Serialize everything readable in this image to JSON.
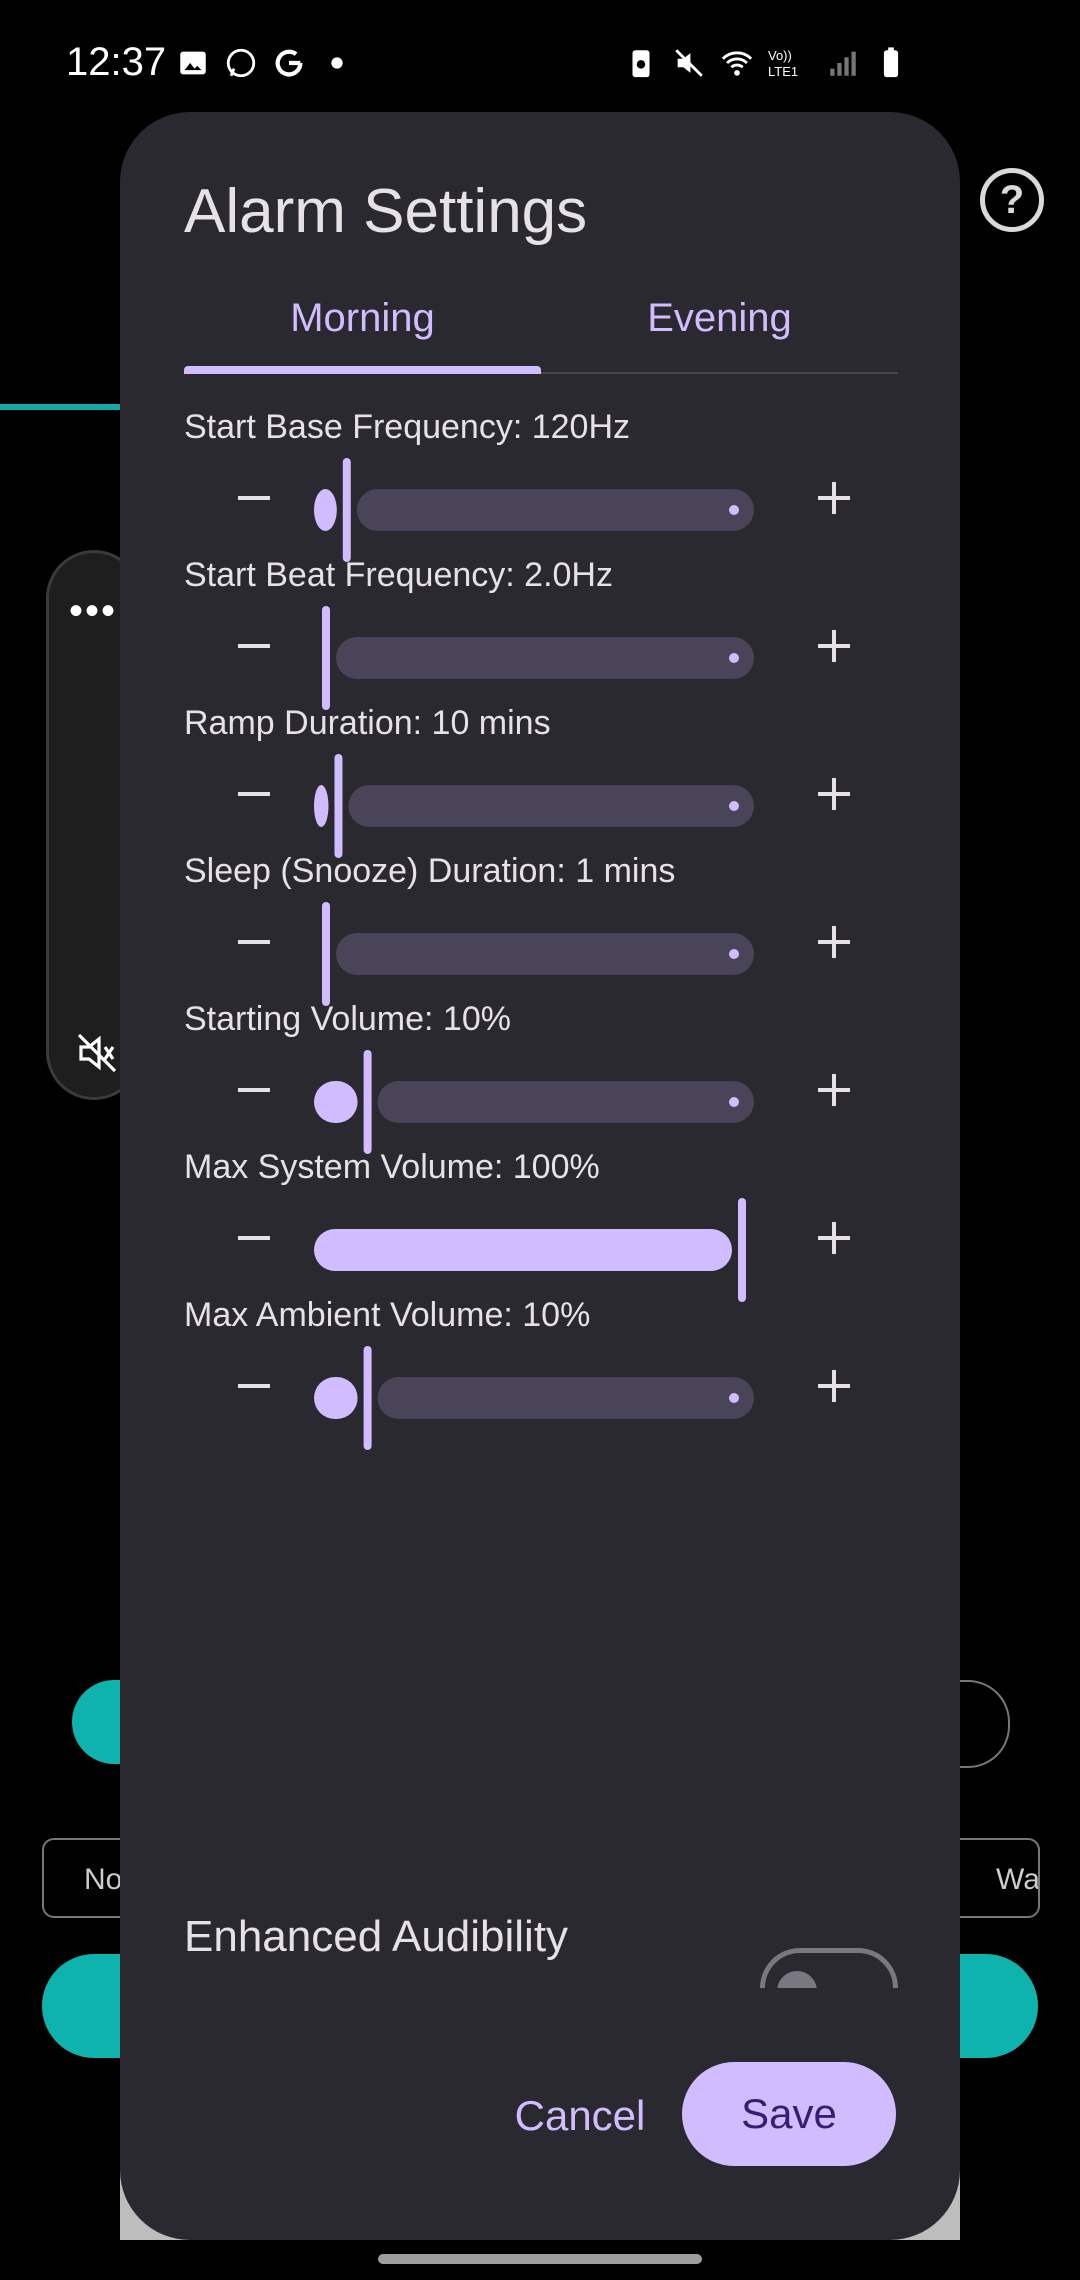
{
  "status_bar": {
    "time": "12:37",
    "left_icons": [
      "image-icon",
      "whatsapp-icon",
      "google-icon",
      "dot-icon"
    ],
    "right_icons": [
      "battery-saver-icon",
      "mute-icon",
      "wifi-icon",
      "volte-icon",
      "signal-icon",
      "battery-icon"
    ],
    "network_label": "Vo)) LTE1"
  },
  "background": {
    "help_icon": "help-icon",
    "chip_left": "No",
    "chip_right": "Wa"
  },
  "volume_panel": {
    "more_icon": "more-icon",
    "mute_icon": "volume-mute-icon"
  },
  "dialog": {
    "title": "Alarm Settings",
    "tabs": [
      {
        "label": "Morning",
        "selected": true
      },
      {
        "label": "Evening",
        "selected": false
      }
    ],
    "settings": [
      {
        "label": "Start Base Frequency: 120Hz",
        "fraction": 0.05
      },
      {
        "label": "Start Beat Frequency: 2.0Hz",
        "fraction": 0.0
      },
      {
        "label": "Ramp Duration: 10 mins",
        "fraction": 0.03
      },
      {
        "label": "Sleep (Snooze) Duration: 1 mins",
        "fraction": 0.0
      },
      {
        "label": "Starting Volume: 10%",
        "fraction": 0.1
      },
      {
        "label": "Max System Volume: 100%",
        "fraction": 1.0
      },
      {
        "label": "Max Ambient Volume: 10%",
        "fraction": 0.1
      }
    ],
    "enhanced_audibility": {
      "label": "Enhanced Audibility",
      "enabled": false
    },
    "buttons": {
      "cancel": "Cancel",
      "save": "Save"
    }
  },
  "colors": {
    "accent": "#d0bcff",
    "track_inactive": "#4a4458",
    "dialog_bg": "#2b2930",
    "teal": "#0fb3ad"
  }
}
